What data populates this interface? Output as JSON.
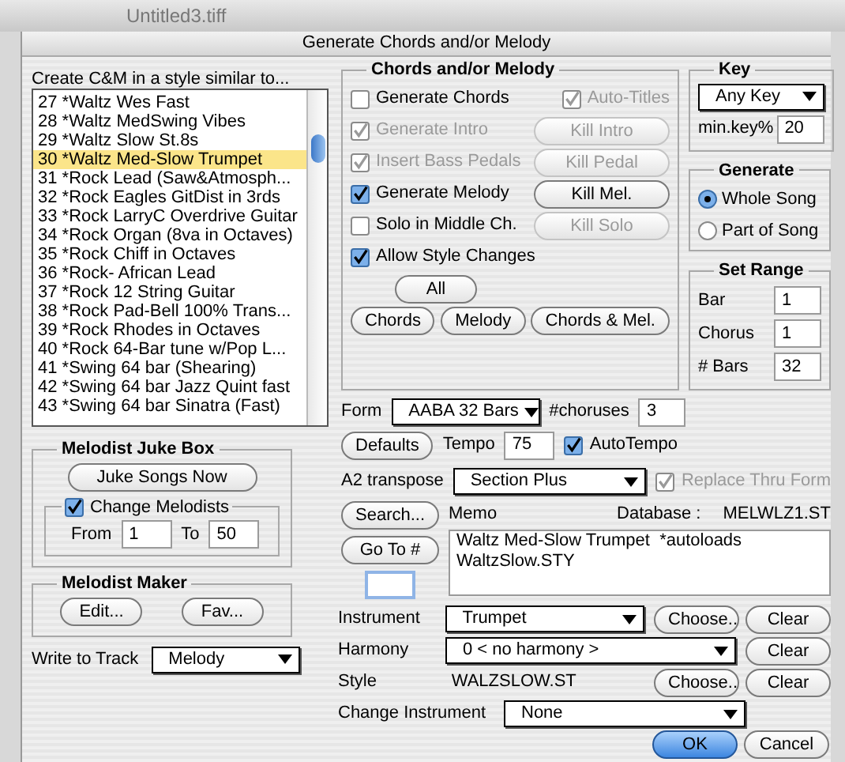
{
  "background_window": {
    "title": "Untitled3.tiff"
  },
  "dialog": {
    "title": "Generate Chords and/or Melody"
  },
  "style_list": {
    "label": "Create C&M in a style similar to...",
    "items": [
      {
        "text": "27 *Waltz Wes Fast",
        "selected": false
      },
      {
        "text": "28 *Waltz MedSwing Vibes",
        "selected": false
      },
      {
        "text": "29 *Waltz Slow St.8s",
        "selected": false
      },
      {
        "text": "30 *Waltz Med-Slow Trumpet",
        "selected": true
      },
      {
        "text": "31 *Rock  Lead (Saw&Atmosph...",
        "selected": false
      },
      {
        "text": "32 *Rock Eagles GitDist in 3rds",
        "selected": false
      },
      {
        "text": "33 *Rock LarryC Overdrive Guitar",
        "selected": false
      },
      {
        "text": "34 *Rock Organ (8va in Octaves)",
        "selected": false
      },
      {
        "text": "35 *Rock  Chiff in Octaves",
        "selected": false
      },
      {
        "text": "36 *Rock- African Lead",
        "selected": false
      },
      {
        "text": "37 *Rock 12 String Guitar",
        "selected": false
      },
      {
        "text": "38 *Rock Pad-Bell 100% Trans...",
        "selected": false
      },
      {
        "text": "39 *Rock Rhodes in Octaves",
        "selected": false
      },
      {
        "text": "40 *Rock 64-Bar tune w/Pop L...",
        "selected": false
      },
      {
        "text": "41 *Swing 64 bar (Shearing)",
        "selected": false
      },
      {
        "text": "42 *Swing 64 bar Jazz Quint fast",
        "selected": false
      },
      {
        "text": "43 *Swing 64 bar Sinatra (Fast)",
        "selected": false
      }
    ]
  },
  "chords_melody": {
    "title": "Chords and/or Melody",
    "rows": [
      {
        "label": "Generate Chords",
        "checked": false,
        "disabled": false,
        "side": {
          "kind": "checkbox",
          "label": "Auto-Titles",
          "checked": true,
          "disabled": true
        }
      },
      {
        "label": "Generate Intro",
        "checked": true,
        "disabled": true,
        "side": {
          "kind": "button",
          "label": "Kill Intro",
          "disabled": true
        }
      },
      {
        "label": "Insert Bass Pedals",
        "checked": true,
        "disabled": true,
        "side": {
          "kind": "button",
          "label": "Kill Pedal",
          "disabled": true
        }
      },
      {
        "label": "Generate Melody",
        "checked": true,
        "disabled": false,
        "side": {
          "kind": "button",
          "label": "Kill Mel.",
          "disabled": false
        }
      },
      {
        "label": "Solo in Middle Ch.",
        "checked": false,
        "disabled": false,
        "side": {
          "kind": "button",
          "label": "Kill Solo",
          "disabled": true
        }
      },
      {
        "label": "Allow Style Changes",
        "checked": true,
        "disabled": false
      }
    ],
    "all_button": "All",
    "buttons": [
      "Chords",
      "Melody",
      "Chords & Mel."
    ]
  },
  "key": {
    "title": "Key",
    "value": "Any Key",
    "min_key_label": "min.key%",
    "min_key": "20"
  },
  "generate": {
    "title": "Generate",
    "options": [
      {
        "label": "Whole Song",
        "selected": true
      },
      {
        "label": "Part of Song",
        "selected": false
      }
    ]
  },
  "set_range": {
    "title": "Set Range",
    "fields": [
      {
        "label": "Bar",
        "value": "1"
      },
      {
        "label": "Chorus",
        "value": "1"
      },
      {
        "label": "# Bars",
        "value": "32"
      }
    ]
  },
  "form_row": {
    "form_label": "Form",
    "form": "AABA 32 Bars",
    "choruses_label": "#choruses",
    "choruses": "3"
  },
  "tempo_row": {
    "defaults_button": "Defaults",
    "tempo_label": "Tempo",
    "tempo": "75",
    "auto_tempo": {
      "label": "AutoTempo",
      "checked": true
    }
  },
  "transpose": {
    "label": "A2 transpose",
    "value": "Section Plus",
    "replace_thru_form": {
      "label": "Replace Thru Form",
      "checked": true,
      "disabled": true
    }
  },
  "memo": {
    "search_button": "Search...",
    "label": "Memo",
    "database_label": "Database :",
    "database": "MELWLZ1.ST",
    "goto_button": "Go To #",
    "text": "Waltz Med-Slow Trumpet  *autoloads\nWaltzSlow.STY"
  },
  "juke_box": {
    "title": "Melodist Juke Box",
    "button": "Juke Songs Now",
    "change_melodists": {
      "label": "Change Melodists",
      "checked": true
    },
    "from_label": "From",
    "from": "1",
    "to_label": "To",
    "to": "50"
  },
  "melodist_maker": {
    "title": "Melodist Maker",
    "buttons": [
      "Edit...",
      "Fav..."
    ]
  },
  "write_to_track": {
    "label": "Write to Track",
    "value": "Melody"
  },
  "assignments": [
    {
      "label": "Instrument",
      "kind": "select",
      "value": "Trumpet",
      "buttons": [
        "Choose..",
        "Clear"
      ]
    },
    {
      "label": "Harmony",
      "kind": "select",
      "value": "0 < no harmony >",
      "buttons": [
        "Clear"
      ]
    },
    {
      "label": "Style",
      "kind": "text",
      "value": "WALZSLOW.ST",
      "buttons": [
        "Choose..",
        "Clear"
      ]
    },
    {
      "label": "Change Instrument",
      "kind": "select",
      "value": "None"
    }
  ],
  "footer_buttons": [
    {
      "label": "OK",
      "default": true
    },
    {
      "label": "Cancel",
      "default": false
    }
  ]
}
